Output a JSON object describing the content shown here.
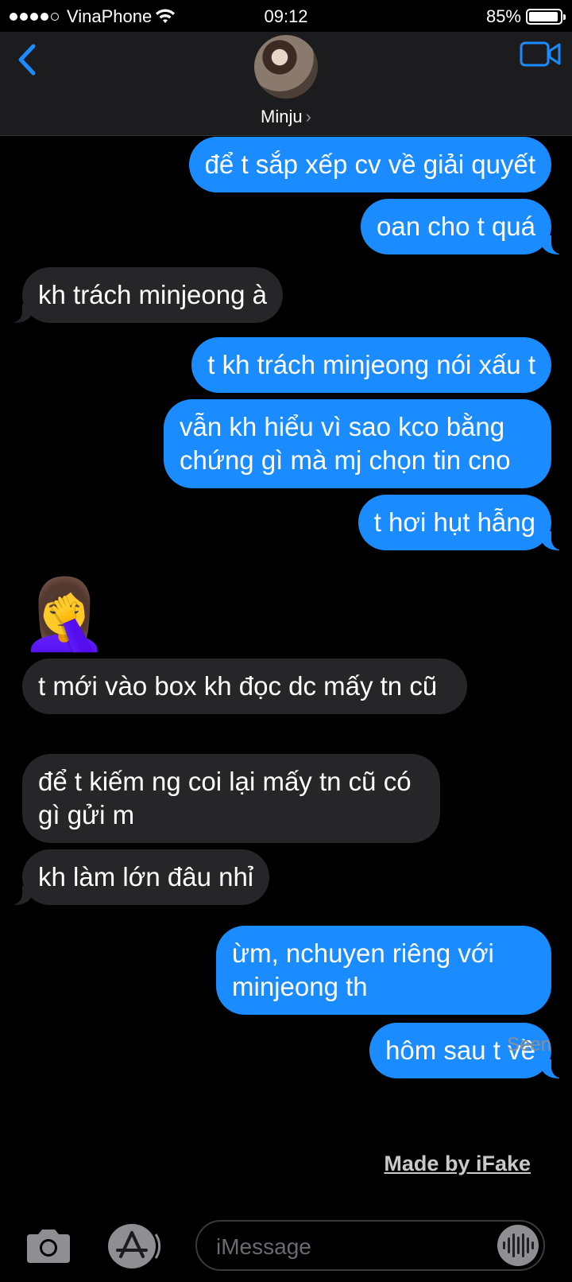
{
  "status": {
    "carrier": "VinaPhone",
    "time": "09:12",
    "battery": "85%"
  },
  "header": {
    "contact_name": "Minju"
  },
  "messages": [
    {
      "dir": "out",
      "text": "để t sắp xếp cv về giải quyết"
    },
    {
      "dir": "out",
      "text": "oan cho t quá"
    },
    {
      "dir": "in",
      "text": "kh trách minjeong à"
    },
    {
      "dir": "out",
      "text": "t kh trách minjeong nói xấu t"
    },
    {
      "dir": "out",
      "text": "vẫn kh hiểu vì sao kco bằng chứng gì mà mj chọn tin cno"
    },
    {
      "dir": "out",
      "text": "t hơi hụt hẫng"
    },
    {
      "dir": "in",
      "text": "🤦‍♀️"
    },
    {
      "dir": "in",
      "text": "t mới vào box kh đọc dc mấy tn cũ"
    },
    {
      "dir": "in",
      "text": "để t kiếm ng coi lại mấy tn cũ có gì gửi m"
    },
    {
      "dir": "in",
      "text": "kh làm lớn đâu nhỉ"
    },
    {
      "dir": "out",
      "text": "ừm, nchuyen riêng với minjeong th"
    },
    {
      "dir": "out",
      "text": "hôm sau t về"
    }
  ],
  "seen_label": "Seen",
  "watermark": "Made by iFake",
  "composer": {
    "placeholder": "iMessage"
  },
  "colors": {
    "outgoing": "#1a8cff",
    "incoming": "#262628",
    "accent": "#1a8cff"
  }
}
